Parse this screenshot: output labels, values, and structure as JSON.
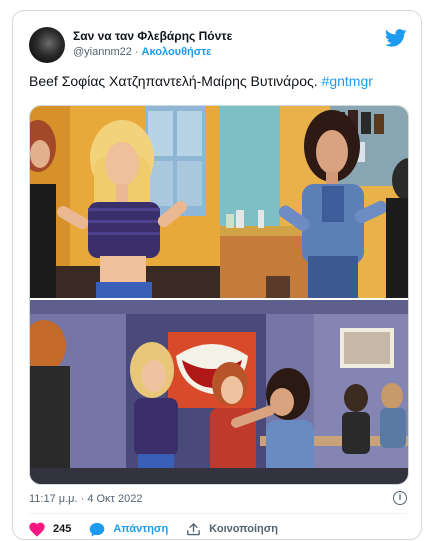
{
  "tweet": {
    "display_name": "Σαν να ταν Φλεβάρης Πόντε",
    "handle": "@yiannm22",
    "separator": "·",
    "follow_label": "Ακολουθήστε",
    "text_main": "Beef Σοφίας Χατζηπαντελή-Μαίρης Βυτινάρος.",
    "hashtag": "#gntmgr",
    "timestamp": "11:17 μ.μ. · 4 Οκτ 2022",
    "info_glyph": "i"
  },
  "actions": {
    "like_count": "245",
    "reply_label": "Απάντηση",
    "share_label": "Κοινοποίηση"
  },
  "colors": {
    "accent": "#1d9bf0",
    "like": "#f91880",
    "text": "#0f1419",
    "muted": "#536471",
    "border": "#cfd9de"
  },
  "icons": [
    "twitter-bird-icon",
    "heart-icon",
    "reply-bubble-icon",
    "share-icon",
    "info-icon"
  ]
}
